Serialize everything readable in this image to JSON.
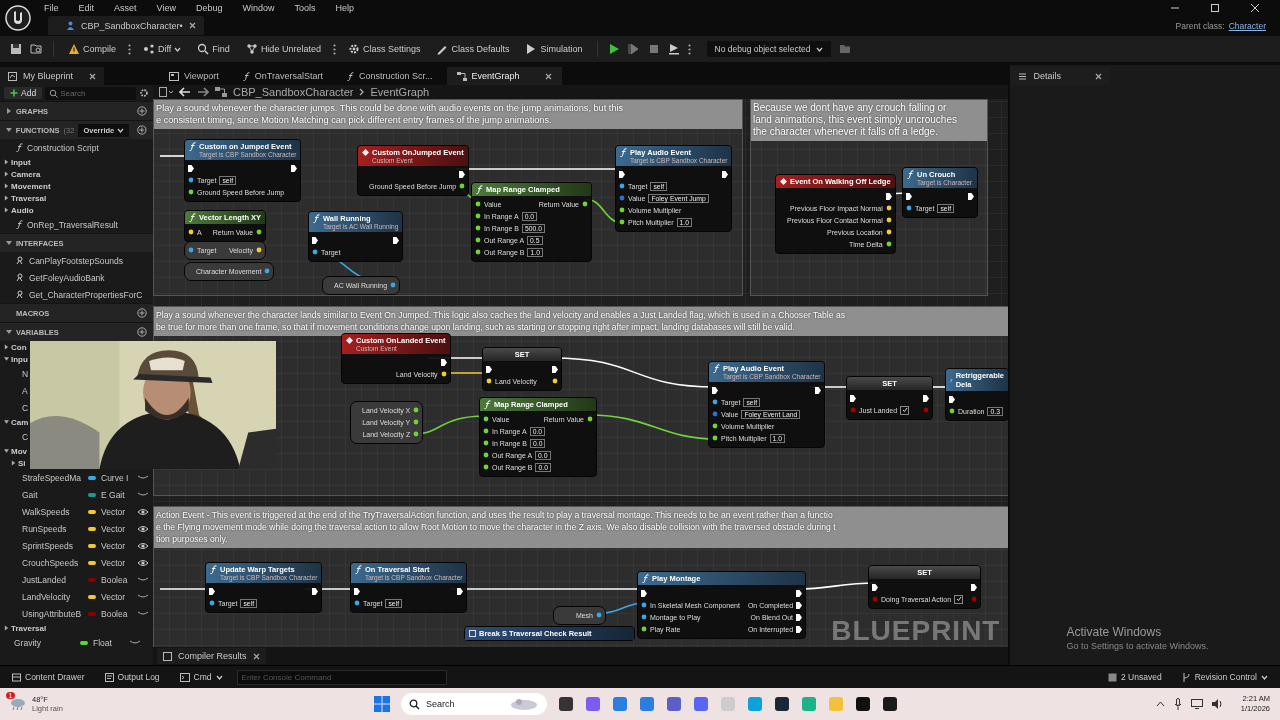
{
  "menu": [
    "File",
    "Edit",
    "Asset",
    "View",
    "Debug",
    "Window",
    "Tools",
    "Help"
  ],
  "document_tab": {
    "label": "CBP_SandboxCharacter•"
  },
  "parent_class": {
    "label": "Parent class:",
    "value": "Character"
  },
  "toolbar": {
    "items": [
      {
        "label": "Compile",
        "kind": "compile"
      },
      {
        "label": "Diff",
        "kind": "diff"
      },
      {
        "label": "Find",
        "kind": "find"
      },
      {
        "label": "Hide Unrelated",
        "kind": "hide"
      },
      {
        "label": "Class Settings",
        "kind": "settings"
      },
      {
        "label": "Class Defaults",
        "kind": "defaults"
      },
      {
        "label": "Simulation",
        "kind": "simulation"
      }
    ],
    "debug_object": "No debug object selected"
  },
  "my_blueprint": {
    "tab": "My Blueprint",
    "add": "Add",
    "search_placeholder": "Search",
    "sections": [
      {
        "label": "GRAPHS",
        "expanded": false,
        "add": true
      },
      {
        "label": "FUNCTIONS",
        "count": "(32",
        "dropdown": "Override",
        "expanded": true,
        "add": true,
        "children": [
          {
            "kind": "function",
            "label": "Construction Script"
          },
          {
            "kind": "category",
            "label": "Input",
            "expanded": false
          },
          {
            "kind": "category",
            "label": "Camera",
            "expanded": false
          },
          {
            "kind": "category",
            "label": "Movement",
            "expanded": false
          },
          {
            "kind": "category",
            "label": "Traversal",
            "expanded": false
          },
          {
            "kind": "category",
            "label": "Audio",
            "expanded": false
          },
          {
            "kind": "function",
            "label": "OnRep_TraversalResult"
          }
        ]
      },
      {
        "label": "INTERFACES",
        "expanded": true,
        "children": [
          {
            "kind": "interface",
            "label": "CanPlayFootstepSounds"
          },
          {
            "kind": "interface",
            "label": "GetFoleyAudioBank"
          },
          {
            "kind": "interface",
            "label": "Get_CharacterPropertiesForC"
          }
        ]
      },
      {
        "label": "MACROS",
        "add": true
      },
      {
        "label": "VARIABLES",
        "expanded": true,
        "add": true,
        "children": [
          {
            "kind": "category",
            "label": "Con",
            "expanded": false
          },
          {
            "kind": "category",
            "label": "Inpu",
            "expanded": true,
            "children": [
              {
                "kind": "variable",
                "label": "N"
              },
              {
                "kind": "variable",
                "label": "A"
              },
              {
                "kind": "variable",
                "label": "C"
              }
            ]
          },
          {
            "kind": "category",
            "label": "Cam",
            "expanded": true,
            "children": [
              {
                "kind": "variable",
                "label": "C"
              }
            ]
          },
          {
            "kind": "category",
            "label": "Mov",
            "expanded": true,
            "children": [
              {
                "kind": "category",
                "label": "Si",
                "expanded": false
              },
              {
                "kind": "variable",
                "label": "StrafeSpeedMa",
                "type": "Curve I",
                "color": "#3aa8e0",
                "exposed": false
              },
              {
                "kind": "variable",
                "label": "Gait",
                "type": "E Gait",
                "color": "#1f9a8a",
                "exposed": false
              },
              {
                "kind": "variable",
                "label": "WalkSpeeds",
                "type": "Vector",
                "color": "#f0c830",
                "exposed": true
              },
              {
                "kind": "variable",
                "label": "RunSpeeds",
                "type": "Vector",
                "color": "#f0c830",
                "exposed": true
              },
              {
                "kind": "variable",
                "label": "SprintSpeeds",
                "type": "Vector",
                "color": "#f0c830",
                "exposed": true
              },
              {
                "kind": "variable",
                "label": "CrouchSpeeds",
                "type": "Vector",
                "color": "#f0c830",
                "exposed": true
              },
              {
                "kind": "variable",
                "label": "JustLanded",
                "type": "Boolea",
                "color": "#8a0000",
                "exposed": false
              },
              {
                "kind": "variable",
                "label": "LandVelocity",
                "type": "Vector",
                "color": "#f0c830",
                "exposed": false
              },
              {
                "kind": "variable",
                "label": "UsingAttributeB",
                "type": "Boolea",
                "color": "#8a0000",
                "exposed": false
              }
            ]
          },
          {
            "kind": "category",
            "label": "Traversal",
            "expanded": false
          },
          {
            "kind": "variable",
            "label": "Gravity",
            "type": "Float",
            "color": "#58d838",
            "exposed": false
          }
        ]
      }
    ]
  },
  "graph_tabs": [
    {
      "label": "Viewport",
      "kind": "viewport",
      "selected": false
    },
    {
      "label": "OnTraversalStart",
      "kind": "function",
      "selected": false
    },
    {
      "label": "Construction Scr...",
      "kind": "function",
      "selected": false
    },
    {
      "label": "EventGraph",
      "kind": "graph",
      "selected": true
    }
  ],
  "details_tab": "Details",
  "graph": {
    "breadcrumb": [
      "CBP_SandboxCharacter",
      "EventGraph"
    ],
    "comments": [
      {
        "lines": [
          "Play a sound whenever the character jumps. This could be done with audio events on the jump animations, but this",
          "e consistent timing, since Motion Matching can pick different entry frames of the jump animations."
        ]
      },
      {
        "lines": [
          "Because we dont have any crouch falling or",
          "land animations, this event simply uncrouches",
          "the character whenever it falls off a ledge."
        ]
      },
      {
        "lines": [
          "Play a sound whenever the character lands similar to Event On Jumped. This logic also caches the land velocity and enables a Just Landed flag, which is used in a Chooser Table as",
          "be true for more than one frame, so that if movement conditions change upon landing, such as starting or stopping right after impact, landing databases will still be valid."
        ]
      },
      {
        "lines": [
          "Action Event - This event is triggered at the end of the TryTraversalAction function, and uses the result to play a traversal montage. This needs to be an event rather than a functio",
          "e the Flying movement mode while doing the traversal action to allow Root Motion to move the character in the Z axis. We also disable collision with the traversed obstacle during t",
          "tion purposes only."
        ]
      }
    ],
    "nodes": [
      {
        "title": "Custom on Jumped Event",
        "subtitle": "Target is CBP Sandbox Character",
        "kind": "function",
        "rows": [
          {
            "in": {
              "kind": "exec"
            },
            "out": {
              "kind": "exec"
            }
          },
          {
            "in": {
              "kind": "object",
              "label": "Target",
              "value": "self"
            }
          },
          {
            "in": {
              "kind": "float",
              "label": "Ground Speed Before Jump"
            }
          }
        ]
      },
      {
        "title": "Custom OnJumped Event",
        "subtitle": "Custom Event",
        "kind": "event",
        "rows": [
          {
            "out": {
              "kind": "exec"
            }
          },
          {
            "out": {
              "kind": "float",
              "label": "Ground Speed Before Jump"
            }
          }
        ]
      },
      {
        "title": "Play Audio Event",
        "subtitle": "Target is CBP Sandbox Character",
        "kind": "function",
        "rows": [
          {
            "in": {
              "kind": "exec"
            },
            "out": {
              "kind": "exec"
            }
          },
          {
            "in": {
              "kind": "object",
              "label": "Target",
              "value": "self"
            }
          },
          {
            "in": {
              "kind": "struct",
              "label": "Value",
              "value": "Foley Event Jump"
            }
          },
          {
            "in": {
              "kind": "float",
              "label": "Volume Multiplier"
            }
          },
          {
            "in": {
              "kind": "float",
              "label": "Pitch Multiplier",
              "value": "1.0"
            }
          }
        ]
      },
      {
        "title": "Un Crouch",
        "subtitle": "Target is Character",
        "kind": "function",
        "rows": [
          {
            "in": {
              "kind": "exec"
            },
            "out": {
              "kind": "exec"
            }
          },
          {
            "in": {
              "kind": "object",
              "label": "Target",
              "value": "self"
            }
          }
        ]
      },
      {
        "title": "Event On Walking Off Ledge",
        "kind": "event",
        "rows": [
          {
            "out": {
              "kind": "exec"
            }
          },
          {
            "out": {
              "kind": "vector",
              "label": "Previous Floor Impact Normal"
            }
          },
          {
            "out": {
              "kind": "vector",
              "label": "Previous Floor Contact Normal"
            }
          },
          {
            "out": {
              "kind": "vector",
              "label": "Previous Location"
            }
          },
          {
            "out": {
              "kind": "float",
              "label": "Time Delta"
            }
          }
        ]
      },
      {
        "title": "Vector Length XY",
        "kind": "pure",
        "rows": [
          {
            "in": {
              "kind": "vector",
              "label": "A"
            },
            "out": {
              "kind": "float",
              "label": "Return Value"
            }
          }
        ]
      },
      {
        "kind": "compact",
        "rows": [
          {
            "in": {
              "kind": "object",
              "label": "Target"
            },
            "out": {
              "kind": "vector",
              "label": "Velocity"
            }
          }
        ]
      },
      {
        "title": "Wall Running",
        "subtitle": "Target is AC Wall Running",
        "kind": "function",
        "rows": [
          {
            "in": {
              "kind": "exec"
            },
            "out": {
              "kind": "exec"
            }
          },
          {
            "in": {
              "kind": "object",
              "label": "Target"
            }
          }
        ]
      },
      {
        "title": "Map Range Clamped",
        "kind": "pure",
        "rows": [
          {
            "in": {
              "kind": "float",
              "label": "Value"
            },
            "out": {
              "kind": "float",
              "label": "Return Value"
            }
          },
          {
            "in": {
              "kind": "float",
              "label": "In Range A",
              "value": "0.0"
            }
          },
          {
            "in": {
              "kind": "float",
              "label": "In Range B",
              "value": "500.0"
            }
          },
          {
            "in": {
              "kind": "float",
              "label": "Out Range A",
              "value": "0.5"
            }
          },
          {
            "in": {
              "kind": "float",
              "label": "Out Range B",
              "value": "1.0"
            }
          }
        ]
      },
      {
        "kind": "compact",
        "rows": [
          {
            "out": {
              "kind": "object",
              "label": "Character Movement"
            }
          }
        ]
      },
      {
        "kind": "compact",
        "rows": [
          {
            "out": {
              "kind": "object",
              "label": "AC Wall Running"
            }
          }
        ]
      },
      {
        "title": "Custom OnLanded Event",
        "subtitle": "Custom Event",
        "kind": "event",
        "rows": [
          {
            "out": {
              "kind": "exec"
            }
          },
          {
            "out": {
              "kind": "vector",
              "label": "Land Velocity"
            }
          }
        ]
      },
      {
        "title": "SET",
        "kind": "set",
        "rows": [
          {
            "in": {
              "kind": "exec"
            },
            "out": {
              "kind": "exec"
            }
          },
          {
            "in": {
              "kind": "vector",
              "label": "Land Velocity"
            },
            "out": {
              "kind": "vector"
            }
          }
        ]
      },
      {
        "kind": "compact",
        "rows": [
          {
            "out": {
              "kind": "float",
              "label": "Land Velocity X"
            }
          },
          {
            "out": {
              "kind": "float",
              "label": "Land Velocity Y"
            }
          },
          {
            "out": {
              "kind": "float",
              "label": "Land Velocity Z"
            }
          }
        ]
      },
      {
        "title": "Map Range Clamped",
        "kind": "pure",
        "rows": [
          {
            "in": {
              "kind": "float",
              "label": "Value"
            },
            "out": {
              "kind": "float",
              "label": "Return Value"
            }
          },
          {
            "in": {
              "kind": "float",
              "label": "In Range A",
              "value": "0.0"
            }
          },
          {
            "in": {
              "kind": "float",
              "label": "In Range B",
              "value": "0.0"
            }
          },
          {
            "in": {
              "kind": "float",
              "label": "Out Range A",
              "value": "0.0"
            }
          },
          {
            "in": {
              "kind": "float",
              "label": "Out Range B",
              "value": "0.0"
            }
          }
        ]
      },
      {
        "title": "Play Audio Event",
        "subtitle": "Target is CBP Sandbox Character",
        "kind": "function",
        "rows": [
          {
            "in": {
              "kind": "exec"
            },
            "out": {
              "kind": "exec"
            }
          },
          {
            "in": {
              "kind": "object",
              "label": "Target",
              "value": "self"
            }
          },
          {
            "in": {
              "kind": "struct",
              "label": "Value",
              "value": "Foley Event Land"
            }
          },
          {
            "in": {
              "kind": "float",
              "label": "Volume Multiplier"
            }
          },
          {
            "in": {
              "kind": "float",
              "label": "Pitch Multiplier",
              "value": "1.0"
            }
          }
        ]
      },
      {
        "title": "SET",
        "kind": "set",
        "rows": [
          {
            "in": {
              "kind": "exec"
            },
            "out": {
              "kind": "exec"
            }
          },
          {
            "in": {
              "kind": "bool",
              "label": "Just Landed",
              "checked": true
            },
            "out": {
              "kind": "bool"
            }
          }
        ]
      },
      {
        "title": "Retriggerable Dela",
        "kind": "function",
        "narrow": true,
        "rows": [
          {
            "in": {
              "kind": "exec"
            }
          },
          {
            "in": {
              "kind": "float",
              "label": "Duration",
              "value": "0.3"
            }
          }
        ]
      },
      {
        "title": "Update Warp Targets",
        "subtitle": "Target is CBP Sandbox Character",
        "kind": "function",
        "rows": [
          {
            "in": {
              "kind": "exec"
            },
            "out": {
              "kind": "exec"
            }
          },
          {
            "in": {
              "kind": "object",
              "label": "Target",
              "value": "self"
            }
          }
        ]
      },
      {
        "title": "On Traversal Start",
        "subtitle": "Target is CBP Sandbox Character",
        "kind": "function",
        "rows": [
          {
            "in": {
              "kind": "exec"
            },
            "out": {
              "kind": "exec"
            }
          },
          {
            "in": {
              "kind": "object",
              "label": "Target",
              "value": "self"
            }
          }
        ]
      },
      {
        "title": "SET",
        "kind": "set",
        "rows": [
          {
            "in": {
              "kind": "exec"
            },
            "out": {
              "kind": "exec"
            }
          },
          {
            "in": {
              "kind": "bool",
              "label": "Doing Traversal Action",
              "checked": true
            },
            "out": {
              "kind": "bool"
            }
          }
        ]
      },
      {
        "title": "Play Montage",
        "kind": "function",
        "rows": [
          {
            "in": {
              "kind": "exec"
            },
            "out": {
              "kind": "exec"
            }
          },
          {
            "in": {
              "kind": "object",
              "label": "In Skeletal Mesh Component"
            },
            "out": {
              "kind": "exec",
              "label": "On Completed"
            }
          },
          {
            "in": {
              "kind": "object",
              "label": "Montage to Play"
            },
            "out": {
              "kind": "exec",
              "label": "On Blend Out"
            }
          },
          {
            "in": {
              "kind": "float",
              "label": "Play Rate"
            },
            "out": {
              "kind": "exec",
              "label": "On Interrupted"
            }
          }
        ]
      },
      {
        "kind": "compact",
        "rows": [
          {
            "out": {
              "kind": "object",
              "label": "Mesh"
            }
          }
        ]
      },
      {
        "title": "Break S Traversal Check Result",
        "kind": "struct"
      }
    ],
    "watermark": "BLUEPRINT"
  },
  "compiler_tab": "Compiler Results",
  "status_bar": {
    "content_drawer": "Content Drawer",
    "output_log": "Output Log",
    "cmd": "Cmd",
    "console_placeholder": "Enter Console Command",
    "unsaved": "2 Unsaved",
    "revision": "Revision Control"
  },
  "activation": {
    "title": "Activate Windows",
    "hint": "Go to Settings to activate Windows."
  },
  "taskbar": {
    "weather_badge": "1",
    "temperature": "48°F",
    "condition": "Light rain",
    "search": "Search",
    "time": "2:21 AM",
    "date": "1/1/2026"
  }
}
